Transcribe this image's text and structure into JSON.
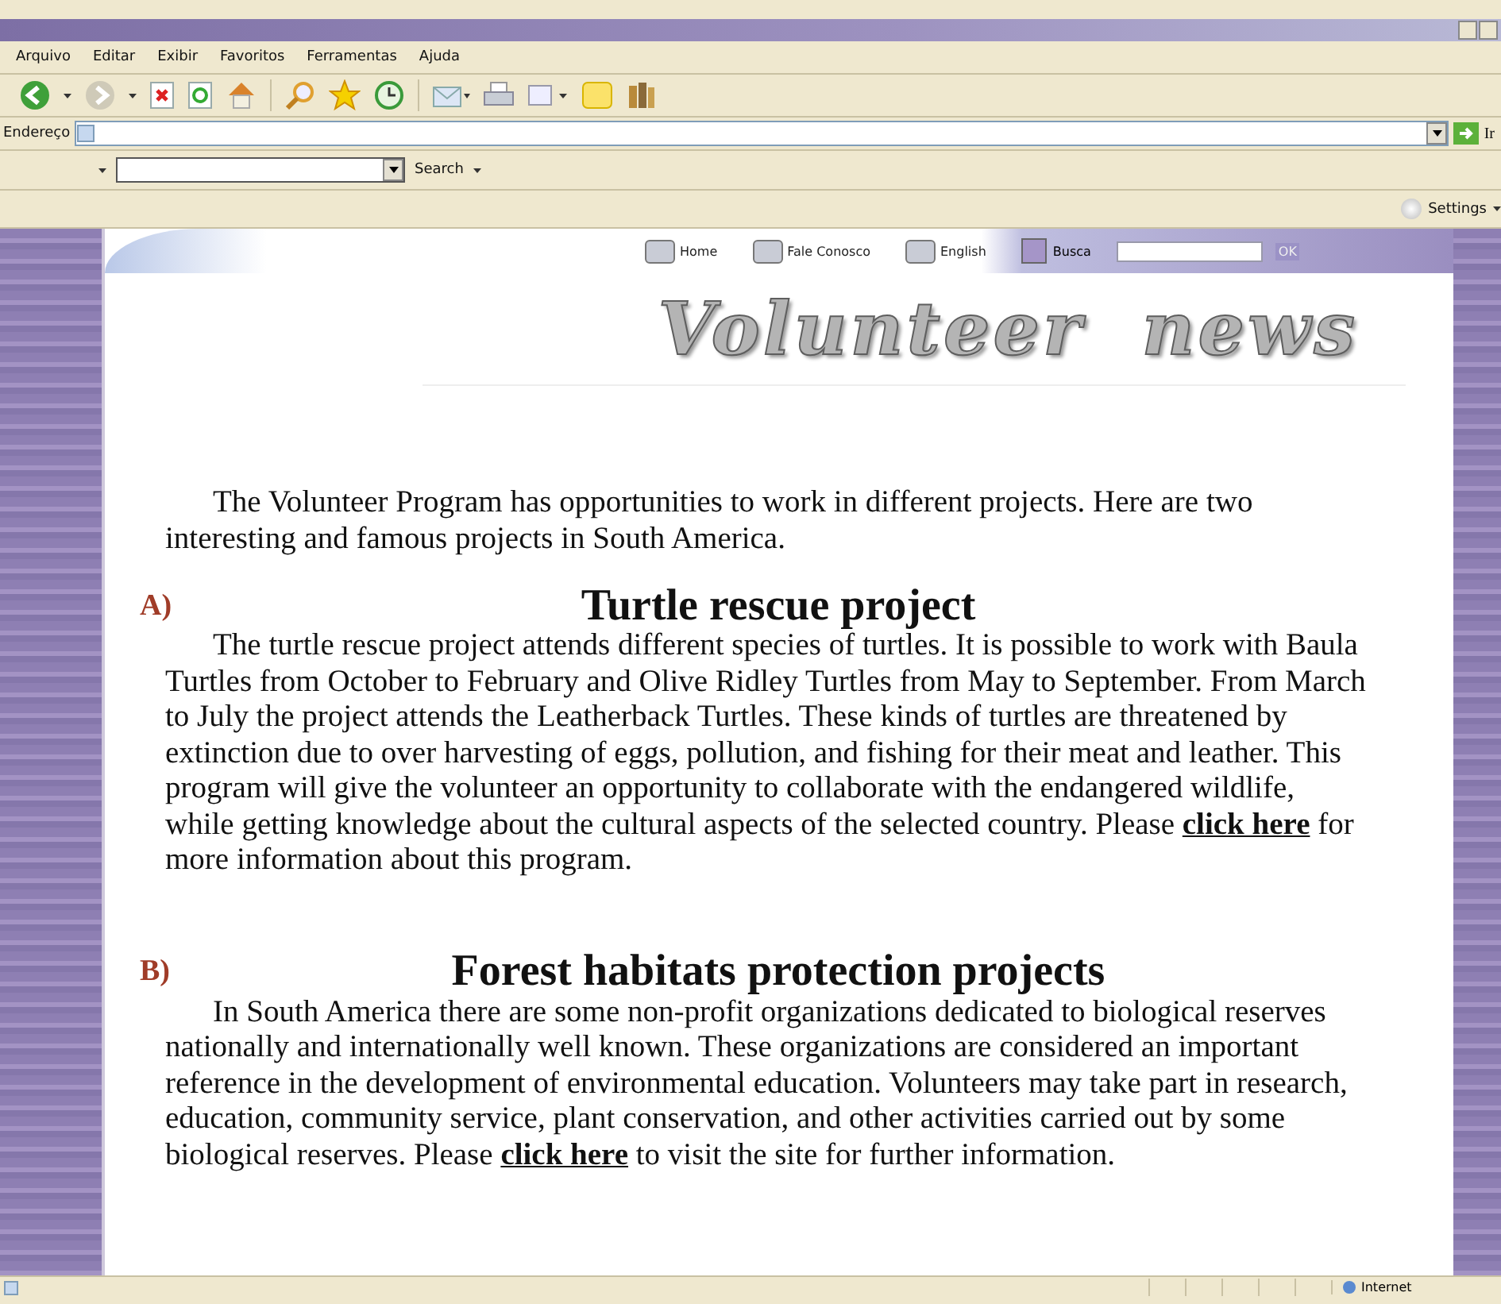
{
  "menu": [
    {
      "label": "Arquivo"
    },
    {
      "label": "Editar"
    },
    {
      "label": "Exibir"
    },
    {
      "label": "Favoritos"
    },
    {
      "label": "Ferramentas"
    },
    {
      "label": "Ajuda"
    }
  ],
  "address": {
    "label": "Endereço",
    "go": "Ir"
  },
  "search_bar": {
    "label": "Search"
  },
  "links_bar": {
    "label": "Settings"
  },
  "site_nav": {
    "items": [
      {
        "label": "Home"
      },
      {
        "label": "Fale Conosco"
      },
      {
        "label": "English"
      }
    ],
    "search_label": "Busca",
    "button": "OK"
  },
  "banner": {
    "title": "Volunteer news"
  },
  "intro": "The Volunteer Program has opportunities to work in different projects. Here are two interesting and famous projects in South America.",
  "sections": [
    {
      "marker": "A)",
      "heading": "Turtle rescue project",
      "before": "The turtle rescue project attends different species of turtles. It is possible to work with Baula Turtles from October to February and Olive Ridley Turtles from May to September. From March to July the project attends the Leatherback Turtles. These kinds of turtles are threatened by extinction due to over harvesting of eggs, pollution, and fishing for their meat and leather. This program will give the volunteer an opportunity to collaborate with the endangered wildlife, while getting knowledge about the cultural aspects of the selected country. Please",
      "link": "click here",
      "after": "for more information about this program."
    },
    {
      "marker": "B)",
      "heading": "Forest habitats protection projects",
      "before": "In South America there are some non-profit organizations dedicated to biological reserves nationally and internationally well known. These organizations are considered an important reference in the development of environmental education. Volunteers may take part in research, education, community service, plant conservation, and other activities carried out by some biological reserves. Please",
      "link": "click here",
      "after": "to visit the site for further information."
    }
  ],
  "status_bar": {
    "zone": "Internet"
  }
}
